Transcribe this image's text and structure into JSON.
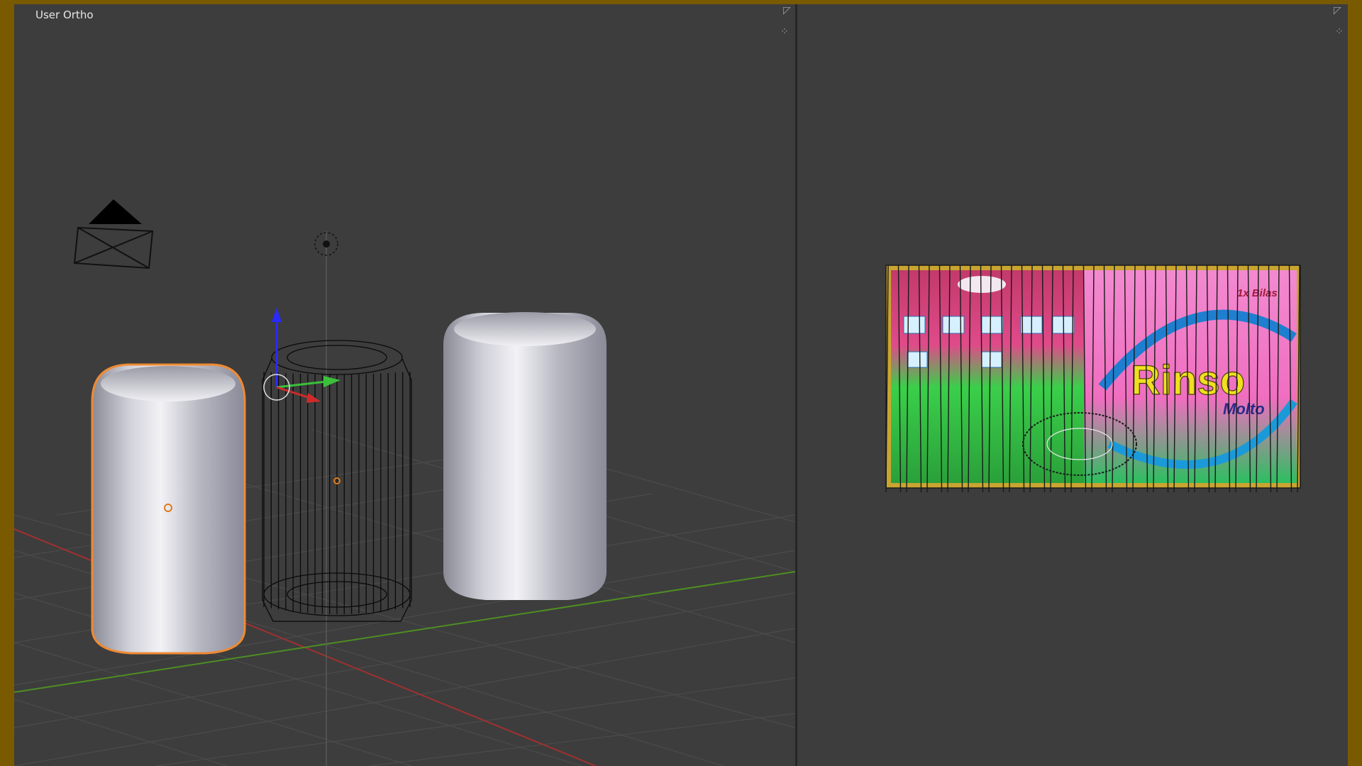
{
  "viewport_3d": {
    "label": "User Ortho",
    "view_type": "perspective-grid",
    "objects": [
      {
        "name": "can-solid-selected",
        "shading": "solid",
        "selected": true
      },
      {
        "name": "can-wireframe",
        "shading": "wireframe",
        "selected": false
      },
      {
        "name": "can-solid",
        "shading": "solid",
        "selected": false
      }
    ],
    "icons": [
      "camera-icon",
      "lamp-icon",
      "transform-manipulator-icon",
      "3d-cursor-icon",
      "area-split-icon"
    ]
  },
  "uv_editor": {
    "image": {
      "brand_text": "Rinso",
      "sub_text": "Molto",
      "badge_text": "1x Bilas"
    },
    "icons": [
      "area-split-icon"
    ]
  },
  "colors": {
    "outer_frame": "#7a5a00",
    "viewport_bg": "#3d3d3d",
    "selection_outline": "#f08a32",
    "x_axis": "#b03434",
    "y_axis": "#5a9a2a",
    "z_arrow": "#2a2aff"
  }
}
